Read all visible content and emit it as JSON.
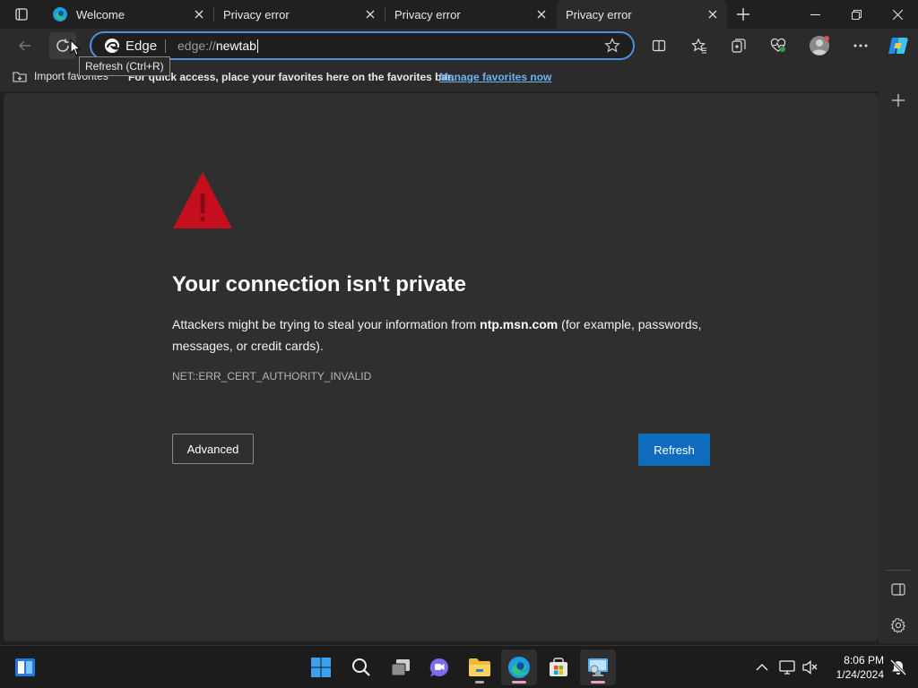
{
  "tabs": [
    {
      "title": "Welcome",
      "icon": "edge-icon"
    },
    {
      "title": "Privacy error",
      "icon": "none"
    },
    {
      "title": "Privacy error",
      "icon": "none"
    },
    {
      "title": "Privacy error",
      "icon": "none",
      "active": true
    }
  ],
  "toolbar": {
    "brand_label": "Edge",
    "url_scheme": "edge://",
    "url_host": "newtab",
    "tooltip": "Refresh (Ctrl+R)"
  },
  "favorites_bar": {
    "import_label": "Import favorites",
    "message": "For quick access, place your favorites here on the favorites bar.",
    "manage_link": "Manage favorites now"
  },
  "error_page": {
    "heading": "Your connection isn't private",
    "desc_prefix": "Attackers might be trying to steal your information from ",
    "desc_host": "ntp.msn.com",
    "desc_suffix": " (for example, passwords, messages, or credit cards).",
    "error_code": "NET::ERR_CERT_AUTHORITY_INVALID",
    "advanced_label": "Advanced",
    "refresh_label": "Refresh"
  },
  "taskbar": {
    "time": "8:06 PM",
    "date": "1/24/2024"
  },
  "colors": {
    "accent": "#0f6cbd",
    "warning": "#c50f1f",
    "link": "#6cb3f2"
  }
}
